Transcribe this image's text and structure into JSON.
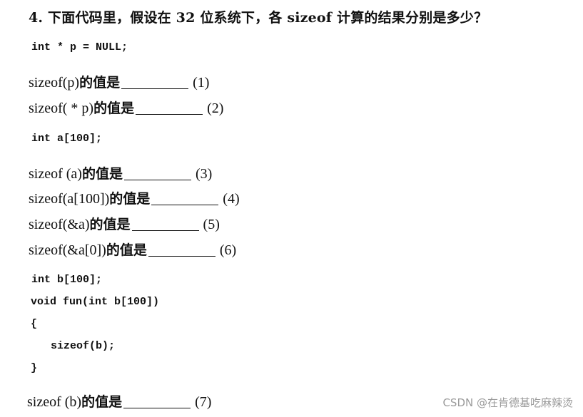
{
  "title": "4. 下面代码里，假设在 32 位系统下，各 sizeof 计算的结果分别是多少？",
  "code_blocks": [
    [
      "int * p = NULL;"
    ],
    [
      "int a[100];"
    ],
    [
      "int b[100];",
      "void fun(int b[100])",
      "{",
      "   sizeof(b);",
      "}"
    ]
  ],
  "questions": [
    {
      "expr": "sizeof(p)",
      "suffix": "的值是",
      "num": "(1)"
    },
    {
      "expr": "sizeof( * p)",
      "suffix": "的值是",
      "num": "(2)"
    },
    {
      "expr": "sizeof (a)",
      "suffix": "的值是",
      "num": "(3)"
    },
    {
      "expr": "sizeof(a[100])",
      "suffix": "的值是",
      "num": "(4)"
    },
    {
      "expr": "sizeof(&a)",
      "suffix": "的值是",
      "num": "(5)"
    },
    {
      "expr": "sizeof(&a[0])",
      "suffix": "的值是",
      "num": "(6)"
    },
    {
      "expr": "sizeof (b)",
      "suffix": "的值是",
      "num": "(7)"
    }
  ],
  "watermark": "CSDN @在肯德基吃麻辣烫"
}
